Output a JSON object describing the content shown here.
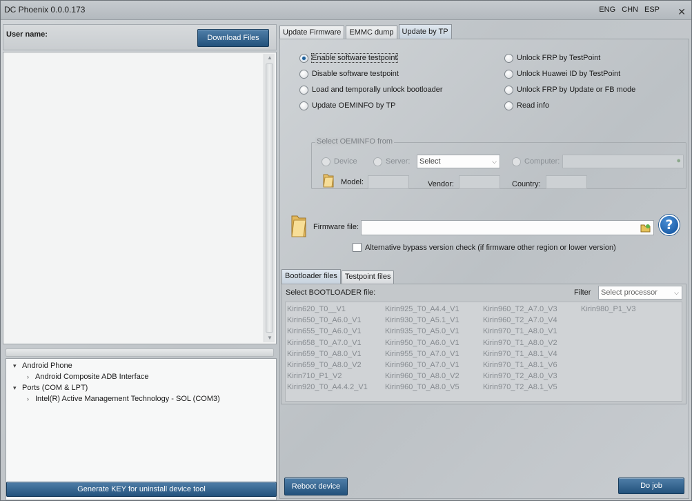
{
  "window": {
    "title": "DC Phoenix 0.0.0.173",
    "languages": [
      "ENG",
      "CHN",
      "ESP"
    ],
    "close_glyph": "✕"
  },
  "left": {
    "user_label": "User name:",
    "download_button": "Download Files",
    "tree": [
      {
        "level": 0,
        "expanded": true,
        "label": "Android Phone"
      },
      {
        "level": 1,
        "expanded": false,
        "label": "Android Composite ADB Interface"
      },
      {
        "level": 0,
        "expanded": true,
        "label": "Ports (COM & LPT)"
      },
      {
        "level": 1,
        "expanded": false,
        "label": "Intel(R) Active Management Technology - SOL (COM3)"
      }
    ],
    "genkey_button": "Generate KEY for uninstall device tool"
  },
  "tabs": [
    "Update Firmware",
    "EMMC dump",
    "Update by TP"
  ],
  "active_tab": 2,
  "options_left": [
    "Enable software testpoint",
    "Disable software testpoint",
    "Load and temporally unlock bootloader",
    "Update OEMINFO by TP"
  ],
  "options_right": [
    "Unlock FRP by TestPoint",
    "Unlock Huawei ID by TestPoint",
    "Unlock FRP by Update or FB mode",
    "Read info"
  ],
  "selected_option": "Enable software testpoint",
  "oeminfo": {
    "legend": "Select OEMINFO from",
    "device": "Device",
    "server": "Server:",
    "server_select": "Select",
    "computer": "Computer:",
    "model": "Model:",
    "vendor": "Vendor:",
    "country": "Country:"
  },
  "firmware": {
    "label": "Firmware file:",
    "value": "",
    "help": "?",
    "bypass_check": "Alternative bypass version check (if firmware other region or lower version)",
    "bypass_checked": false
  },
  "files": {
    "subtabs": [
      "Bootloader files",
      "Testpoint files"
    ],
    "active_subtab": 0,
    "select_label": "Select BOOTLOADER file:",
    "filter_label": "Filter",
    "filter_placeholder": "Select processor",
    "columns": [
      [
        "Kirin620_T0__V1",
        "Kirin650_T0_A6.0_V1",
        "Kirin655_T0_A6.0_V1",
        "Kirin658_T0_A7.0_V1",
        "Kirin659_T0_A8.0_V1",
        "Kirin659_T0_A8.0_V2",
        "Kirin710_P1_V2",
        "Kirin920_T0_A4.4.2_V1"
      ],
      [
        "Kirin925_T0_A4.4_V1",
        "Kirin930_T0_A5.1_V1",
        "Kirin935_T0_A5.0_V1",
        "Kirin950_T0_A6.0_V1",
        "Kirin955_T0_A7.0_V1",
        "Kirin960_T0_A7.0_V1",
        "Kirin960_T0_A8.0_V2",
        "Kirin960_T0_A8.0_V5"
      ],
      [
        "Kirin960_T2_A7.0_V3",
        "Kirin960_T2_A7.0_V4",
        "Kirin970_T1_A8.0_V1",
        "Kirin970_T1_A8.0_V2",
        "Kirin970_T1_A8.1_V4",
        "Kirin970_T1_A8.1_V6",
        "Kirin970_T2_A8.0_V3",
        "Kirin970_T2_A8.1_V5"
      ],
      [
        "Kirin980_P1_V3"
      ]
    ]
  },
  "buttons": {
    "reboot": "Reboot device",
    "do_job": "Do job"
  }
}
